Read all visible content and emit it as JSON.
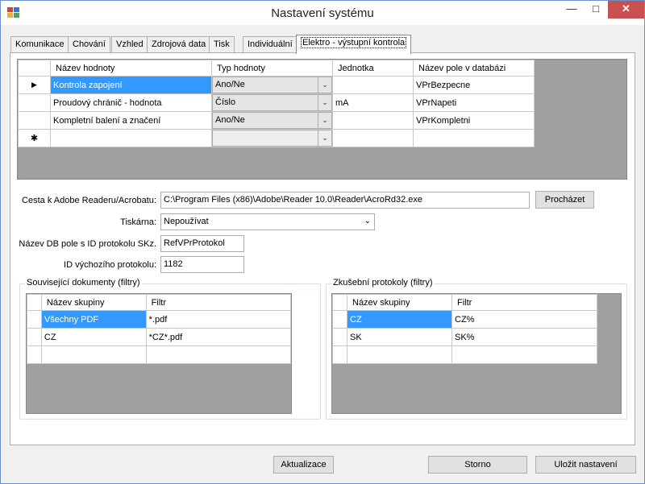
{
  "window": {
    "title": "Nastavení systému"
  },
  "tabs": [
    "Komunikace",
    "Chování",
    "Vzhled",
    "Zdrojová data",
    "Tisk",
    "Individuální",
    "Elektro - výstupní kontrola"
  ],
  "active_tab": "Elektro - výstupní kontrola",
  "values_grid": {
    "columns": [
      "Název hodnoty",
      "Typ hodnoty",
      "Jednotka",
      "Název pole v databázi"
    ],
    "rows": [
      {
        "marker": "▶",
        "name": "Kontrola zapojení",
        "type": "Ano/Ne",
        "unit": "",
        "db_field": "VPrBezpecne"
      },
      {
        "marker": "",
        "name": "Proudový chránič - hodnota",
        "type": "Číslo",
        "unit": "mA",
        "db_field": "VPrNapeti"
      },
      {
        "marker": "",
        "name": "Kompletní balení a značení",
        "type": "Ano/Ne",
        "unit": "",
        "db_field": "VPrKompletni"
      },
      {
        "marker": "✱",
        "name": "",
        "type": "",
        "unit": "",
        "db_field": ""
      }
    ]
  },
  "form": {
    "reader_path_label": "Cesta k Adobe Readeru/Acrobatu:",
    "reader_path_value": "C:\\Program Files (x86)\\Adobe\\Reader 10.0\\Reader\\AcroRd32.exe",
    "browse_label": "Procházet",
    "printer_label": "Tiskárna:",
    "printer_value": "Nepoužívat",
    "db_field_label": "Název DB pole s ID protokolu SKz.",
    "db_field_value": "RefVPrProtokol",
    "default_protocol_label": "ID výchozího protokolu:",
    "default_protocol_value": "1182"
  },
  "related_docs": {
    "title": "Související dokumenty (filtry)",
    "columns": [
      "Název skupiny",
      "Filtr"
    ],
    "rows": [
      {
        "group": "Všechny PDF",
        "filter": "*.pdf"
      },
      {
        "group": "CZ",
        "filter": "*CZ*.pdf"
      },
      {
        "group": "",
        "filter": ""
      }
    ]
  },
  "test_protocols": {
    "title": "Zkušební protokoly (filtry)",
    "columns": [
      "Název skupiny",
      "Filtr"
    ],
    "rows": [
      {
        "group": "CZ",
        "filter": "CZ%"
      },
      {
        "group": "SK",
        "filter": "SK%"
      },
      {
        "group": "",
        "filter": ""
      }
    ]
  },
  "buttons": {
    "update": "Aktualizace",
    "cancel": "Storno",
    "save": "Uložit nastavení"
  },
  "colors": {
    "selection": "#3399ff",
    "grid_background": "#a0a0a0",
    "close_button": "#c75050"
  }
}
